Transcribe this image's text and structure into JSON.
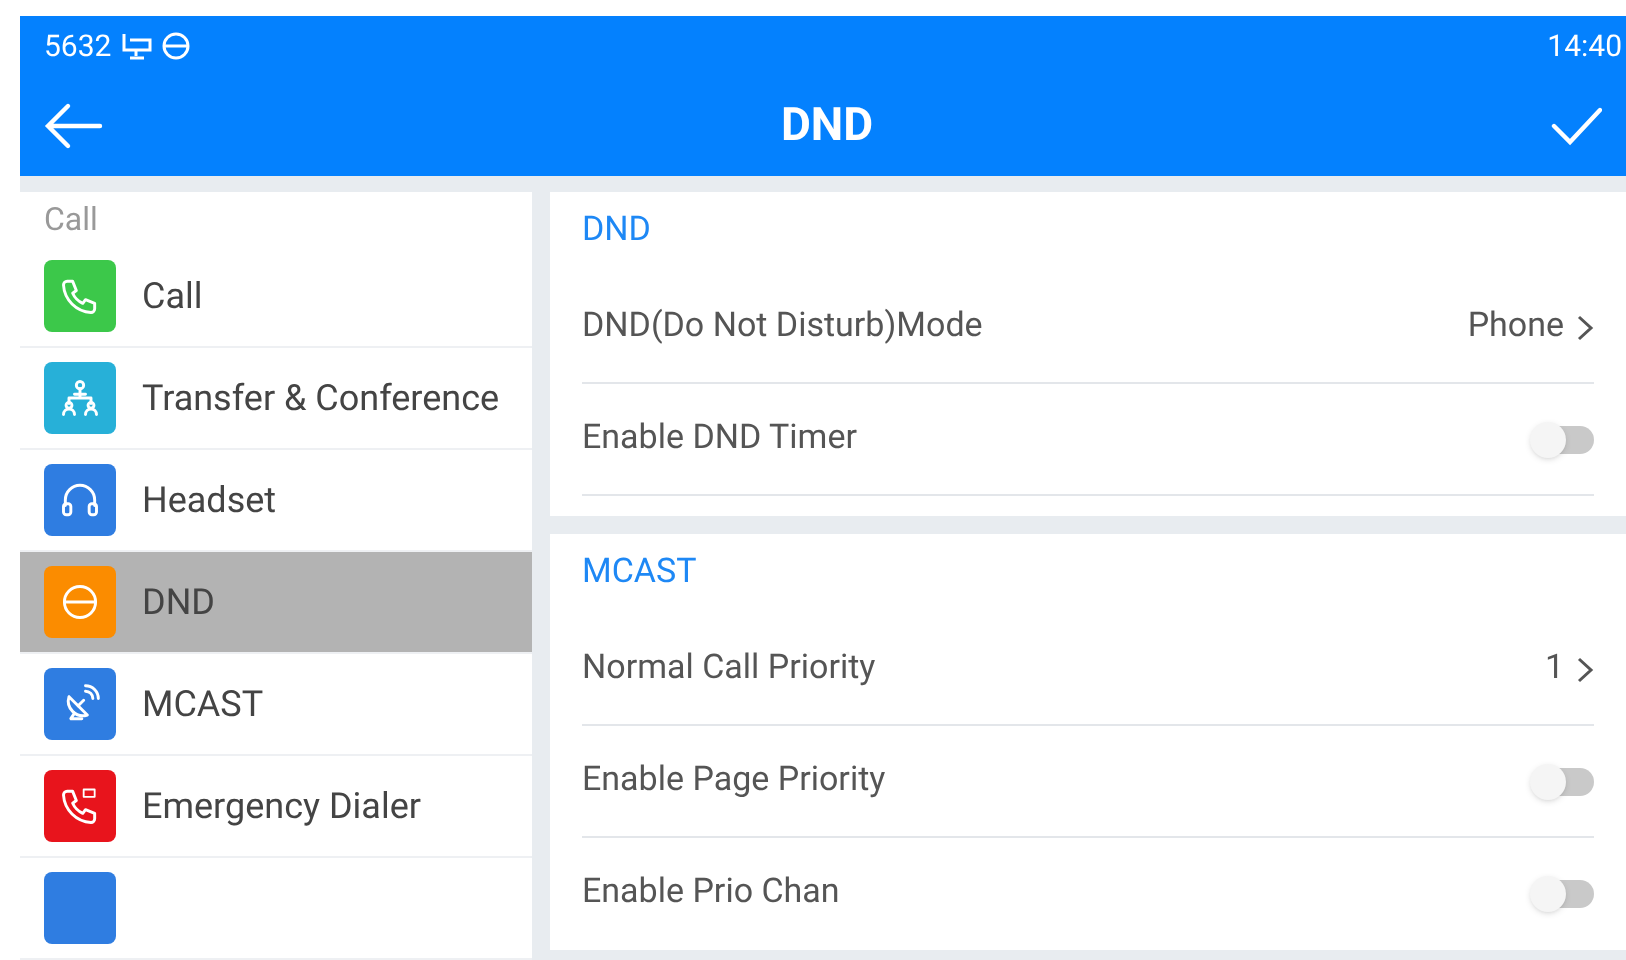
{
  "status_bar": {
    "extension": "5632",
    "time": "14:40"
  },
  "title_bar": {
    "title": "DND"
  },
  "sidebar": {
    "heading": "Call",
    "items": [
      {
        "kind": "phone",
        "label": "Call",
        "color": "#3cc84a",
        "selected": false
      },
      {
        "kind": "conference",
        "label": "Transfer & Conference",
        "color": "#27b0d8",
        "selected": false
      },
      {
        "kind": "headset",
        "label": "Headset",
        "color": "#2f7de1",
        "selected": false
      },
      {
        "kind": "dnd",
        "label": "DND",
        "color": "#fb8c00",
        "selected": true
      },
      {
        "kind": "dish",
        "label": "MCAST",
        "color": "#2f7de1",
        "selected": false
      },
      {
        "kind": "sos",
        "label": "Emergency Dialer",
        "color": "#e8141c",
        "selected": false
      },
      {
        "kind": "blank",
        "color": "#2f7de1",
        "selected": false
      }
    ]
  },
  "sections": [
    {
      "title": "DND",
      "rows": [
        {
          "kind": "value",
          "label": "DND(Do Not Disturb)Mode",
          "value": "Phone"
        },
        {
          "kind": "toggle",
          "label": "Enable DND Timer",
          "on": false
        }
      ]
    },
    {
      "title": "MCAST",
      "rows": [
        {
          "kind": "value",
          "label": "Normal Call Priority",
          "value": "1"
        },
        {
          "kind": "toggle",
          "label": "Enable Page Priority",
          "on": false
        },
        {
          "kind": "toggle",
          "label": "Enable Prio Chan",
          "on": false
        }
      ]
    }
  ]
}
